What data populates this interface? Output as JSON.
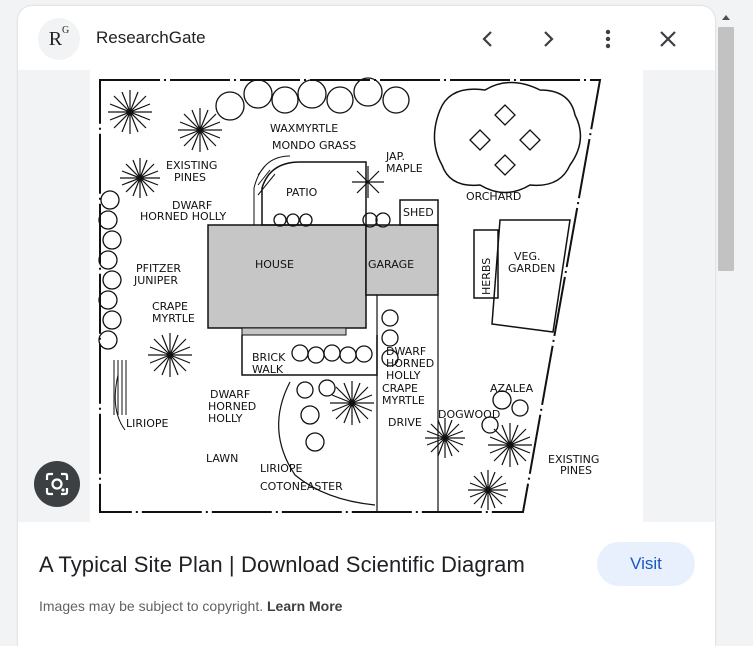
{
  "header": {
    "source_name": "ResearchGate",
    "favicon_text": "R",
    "favicon_sup": "G"
  },
  "icons": {
    "prev": "chevron-left-icon",
    "next": "chevron-right-icon",
    "more": "more-vert-icon",
    "close": "close-icon",
    "lens": "google-lens-icon"
  },
  "plan_labels": {
    "waxmyrtle": "WAXMYRTLE",
    "mondo": "MONDO GRASS",
    "jap": "JAP.",
    "maple": "MAPLE",
    "existing1": "EXISTING",
    "pines1": "PINES",
    "patio": "PATIO",
    "orchard": "ORCHARD",
    "dwarf1": "DWARF",
    "horned_holly1": "HORNED HOLLY",
    "shed": "SHED",
    "house": "HOUSE",
    "garage": "GARAGE",
    "herbs": "HERBS",
    "veg": "VEG.",
    "garden": "GARDEN",
    "pfitzer": "PFITZER",
    "juniper": "JUNIPER",
    "crape1": "CRAPE",
    "myrtle1": "MYRTLE",
    "brick": "BRICK",
    "walk": "WALK",
    "dwarf2": "DWARF",
    "horned2": "HORNED",
    "holly2": "HOLLY",
    "crape2": "CRAPE",
    "myrtle2": "MYRTLE",
    "azalea": "AZALEA",
    "dwarf3": "DWARF",
    "horned3": "HORNED",
    "holly3": "HOLLY",
    "liriope1": "LIRIOPE",
    "drive": "DRIVE",
    "dogwood": "DOGWOOD",
    "lawn": "LAWN",
    "liriope2": "LIRIOPE",
    "existing2": "EXISTING",
    "pines2": "PINES",
    "cotoneaster": "COTONEASTER"
  },
  "result": {
    "title": "A Typical Site Plan | Download Scientific Diagram",
    "visit_label": "Visit",
    "copyright_text": "Images may be subject to copyright.",
    "learn_more": "Learn More"
  },
  "colors": {
    "visit_bg": "#e8f0fe",
    "visit_text": "#1a57c2",
    "building_fill": "#c6c6c6"
  }
}
